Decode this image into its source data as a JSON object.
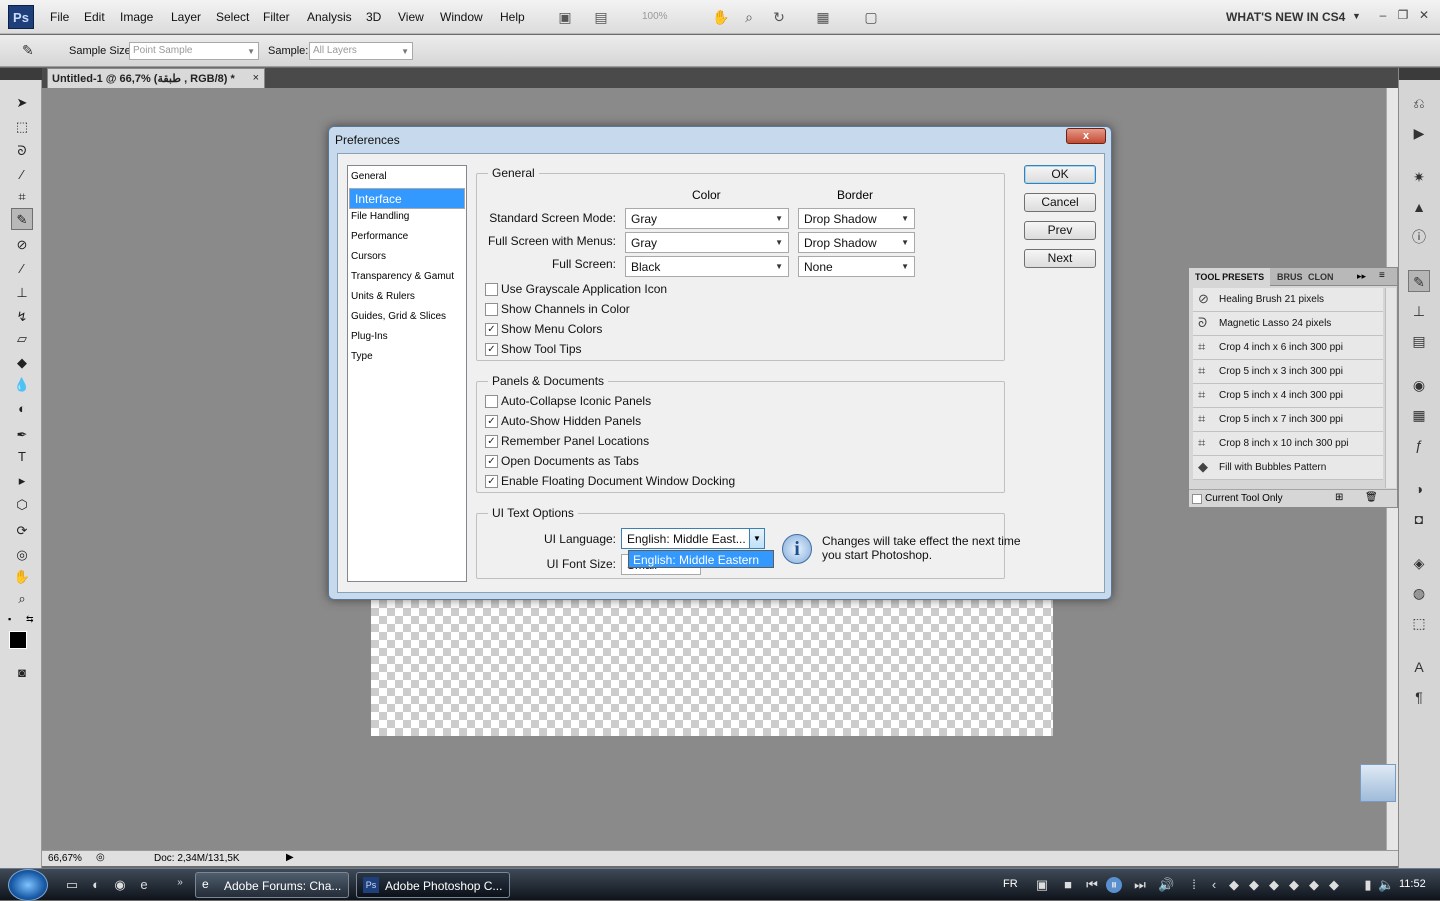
{
  "app": {
    "logo": "Ps"
  },
  "menubar": {
    "items": [
      "File",
      "Edit",
      "Image",
      "Layer",
      "Select",
      "Filter",
      "Analysis",
      "3D",
      "View",
      "Window",
      "Help"
    ],
    "zoom": "100%",
    "workspace": "WHAT'S NEW IN CS4"
  },
  "options": {
    "sample_size_label": "Sample Size:",
    "sample_size_value": "Point Sample",
    "sample_label": "Sample:",
    "sample_value": "All Layers"
  },
  "document": {
    "tab_title": "Untitled-1 @ 66,7% (طبقة , RGB/8) *",
    "close": "×",
    "zoom": "66,67%",
    "doc_info": "Doc: 2,34M/131,5K"
  },
  "tool_presets": {
    "tabs": [
      "TOOL PRESETS",
      "BRUS",
      "CLON"
    ],
    "items": [
      "Healing Brush 21 pixels",
      "Magnetic Lasso 24 pixels",
      "Crop 4 inch x 6 inch 300 ppi",
      "Crop 5 inch x 3 inch 300 ppi",
      "Crop 5 inch x 4 inch 300 ppi",
      "Crop 5 inch x 7 inch 300 ppi",
      "Crop 8 inch x 10 inch 300 ppi",
      "Fill with Bubbles Pattern"
    ],
    "current_tool_only": "Current Tool Only"
  },
  "dialog": {
    "title": "Preferences",
    "close": "x",
    "categories": [
      "General",
      "Interface",
      "File Handling",
      "Performance",
      "Cursors",
      "Transparency & Gamut",
      "Units & Rulers",
      "Guides, Grid & Slices",
      "Plug-Ins",
      "Type"
    ],
    "selected_category": "Interface",
    "general": {
      "title": "General",
      "col_color": "Color",
      "col_border": "Border",
      "rows": [
        {
          "label": "Standard Screen Mode:",
          "color": "Gray",
          "border": "Drop Shadow"
        },
        {
          "label": "Full Screen with Menus:",
          "color": "Gray",
          "border": "Drop Shadow"
        },
        {
          "label": "Full Screen:",
          "color": "Black",
          "border": "None"
        }
      ],
      "checkboxes": [
        {
          "label": "Use Grayscale Application Icon",
          "checked": false
        },
        {
          "label": "Show Channels in Color",
          "checked": false
        },
        {
          "label": "Show Menu Colors",
          "checked": true
        },
        {
          "label": "Show Tool Tips",
          "checked": true
        }
      ]
    },
    "panels": {
      "title": "Panels & Documents",
      "checkboxes": [
        {
          "label": "Auto-Collapse Iconic Panels",
          "checked": false
        },
        {
          "label": "Auto-Show Hidden Panels",
          "checked": true
        },
        {
          "label": "Remember Panel Locations",
          "checked": true
        },
        {
          "label": "Open Documents as Tabs",
          "checked": true
        },
        {
          "label": "Enable Floating Document Window Docking",
          "checked": true
        }
      ]
    },
    "ui_text": {
      "title": "UI Text Options",
      "language_label": "UI Language:",
      "language_value": "English: Middle East...",
      "language_option": "English: Middle Eastern",
      "font_size_label": "UI Font Size:",
      "font_size_value": "Small",
      "note": "Changes will take effect the next time you start Photoshop."
    },
    "buttons": [
      "OK",
      "Cancel",
      "Prev",
      "Next"
    ]
  },
  "taskbar": {
    "windows": [
      "Adobe Forums: Cha...",
      "Adobe Photoshop C..."
    ],
    "language": "FR",
    "time": "11:52"
  }
}
